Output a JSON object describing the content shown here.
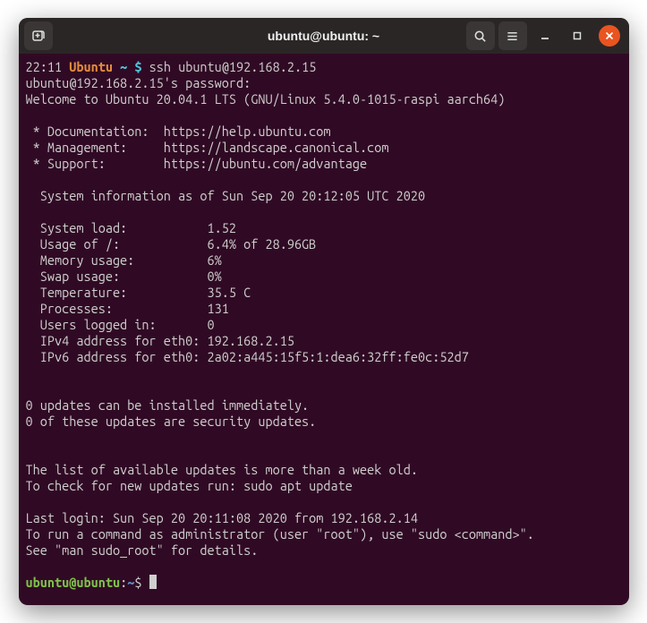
{
  "window": {
    "title": "ubuntu@ubuntu: ~"
  },
  "prompt1": {
    "time": "22:11",
    "host": "Ubuntu",
    "path": "~",
    "symbol": "$",
    "command": "ssh ubuntu@192.168.2.15"
  },
  "motd": {
    "pw_line": "ubuntu@192.168.2.15's password:",
    "welcome": "Welcome to Ubuntu 20.04.1 LTS (GNU/Linux 5.4.0-1015-raspi aarch64)",
    "doc": " * Documentation:  https://help.ubuntu.com",
    "mgmt": " * Management:     https://landscape.canonical.com",
    "sup": " * Support:        https://ubuntu.com/advantage",
    "sysinfo_hdr": "  System information as of Sun Sep 20 20:12:05 UTC 2020",
    "stats": {
      "load": "  System load:           1.52",
      "usage": "  Usage of /:            6.4% of 28.96GB",
      "mem": "  Memory usage:          6%",
      "swap": "  Swap usage:            0%",
      "temp": "  Temperature:           35.5 C",
      "proc": "  Processes:             131",
      "users": "  Users logged in:       0",
      "ipv4": "  IPv4 address for eth0: 192.168.2.15",
      "ipv6": "  IPv6 address for eth0: 2a02:a445:15f5:1:dea6:32ff:fe0c:52d7"
    },
    "updates1": "0 updates can be installed immediately.",
    "updates2": "0 of these updates are security updates.",
    "stale1": "The list of available updates is more than a week old.",
    "stale2": "To check for new updates run: sudo apt update",
    "lastlogin": "Last login: Sun Sep 20 20:11:08 2020 from 192.168.2.14",
    "sudo1": "To run a command as administrator (user \"root\"), use \"sudo <command>\".",
    "sudo2": "See \"man sudo_root\" for details."
  },
  "prompt2": {
    "userhost": "ubuntu@ubuntu",
    "colon": ":",
    "path": "~",
    "symbol": "$"
  }
}
